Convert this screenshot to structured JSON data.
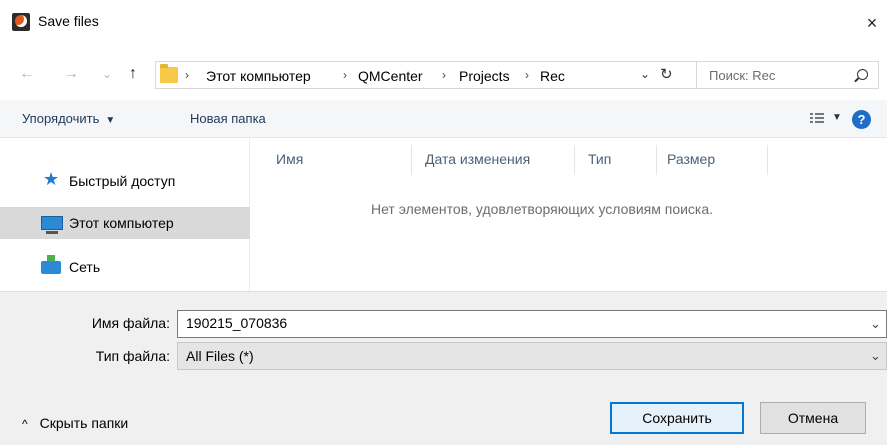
{
  "window": {
    "title": "Save files",
    "close_glyph": "×"
  },
  "nav": {
    "back_glyph": "←",
    "forward_glyph": "→",
    "recent_glyph": "⌄",
    "up_glyph": "↑",
    "breadcrumb": [
      "Этот компьютер",
      "QMCenter",
      "Projects",
      "Rec"
    ],
    "breadcrumb_sep": "›",
    "dropdown_glyph": "⌄",
    "refresh_glyph": "↻",
    "search_placeholder": "Поиск: Rec"
  },
  "toolbar": {
    "organize_label": "Упорядочить",
    "organize_caret": "▼",
    "new_folder_label": "Новая папка",
    "view_caret": "▼",
    "help_glyph": "?"
  },
  "sidebar": {
    "items": [
      {
        "label": "Быстрый доступ",
        "icon": "star-icon",
        "selected": false
      },
      {
        "label": "Этот компьютер",
        "icon": "computer-icon",
        "selected": true
      },
      {
        "label": "Сеть",
        "icon": "network-icon",
        "selected": false
      }
    ]
  },
  "filelist": {
    "columns": [
      "Имя",
      "Дата изменения",
      "Тип",
      "Размер"
    ],
    "empty_message": "Нет элементов, удовлетворяющих условиям поиска."
  },
  "form": {
    "filename_label": "Имя файла:",
    "filename_value": "190215_070836",
    "filetype_label": "Тип файла:",
    "filetype_value": "All Files (*)",
    "dropdown_glyph": "⌄"
  },
  "footer": {
    "hide_folders_chevron": "^",
    "hide_folders_label": "Скрыть папки",
    "save_label": "Сохранить",
    "cancel_label": "Отмена"
  }
}
